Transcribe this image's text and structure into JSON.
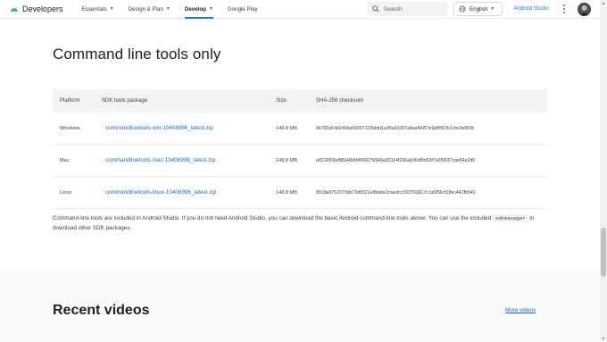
{
  "header": {
    "brand": "Developers",
    "nav": [
      {
        "label": "Essentials",
        "has_menu": true,
        "active": false
      },
      {
        "label": "Design & Plan",
        "has_menu": true,
        "active": false
      },
      {
        "label": "Develop",
        "has_menu": true,
        "active": true
      },
      {
        "label": "Google Play",
        "has_menu": false,
        "active": false
      }
    ],
    "search_placeholder": "Search",
    "language": "English",
    "android_studio_link": "Android Studio"
  },
  "main": {
    "title": "Command line tools only",
    "table": {
      "headers": [
        "Platform",
        "SDK tools package",
        "Size",
        "SHA-256 checksum"
      ],
      "rows": [
        {
          "platform": "Windows",
          "package": "commandlinetools-win-10406996_latest.zip",
          "size": "148.8 MB",
          "checksum": "9b782a54d246ba5d20711f0ddd1a35a91087a8aaf4057e9df6f97b1cbc0ef60fc"
        },
        {
          "platform": "Mac",
          "package": "commandlinetools-mac-10406996_latest.zip",
          "size": "148.8 MB",
          "checksum": "e8216f09e885d4b6f4f06675f949a92114f196ab36df9d63f7a5f9037cae64e2d6"
        },
        {
          "platform": "Linux",
          "package": "commandlinetools-linux-10406996_latest.zip",
          "size": "148.8 MB",
          "checksum": "8919e8752979db73d8321e9babe2caedcc393750817c1a5f56cf28ec442fb540"
        }
      ]
    },
    "note_before": "Command-line tools are included in Android Studio. If you do not need Android Studio, you can download the basic Android command-line tools above. You can use the included ",
    "note_code": "sdkmanager",
    "note_after": " to download other SDK packages."
  },
  "recent": {
    "title": "Recent videos",
    "more_link": "More videos"
  },
  "colors": {
    "accent": "#1a73e8",
    "link": "#1967d2",
    "table_header_bg": "#f1f3f4",
    "section_bg": "#f8f9fa"
  },
  "icons": [
    "android-logo-icon",
    "chevron-down-icon",
    "search-icon",
    "globe-icon",
    "more-vert-icon",
    "avatar"
  ]
}
